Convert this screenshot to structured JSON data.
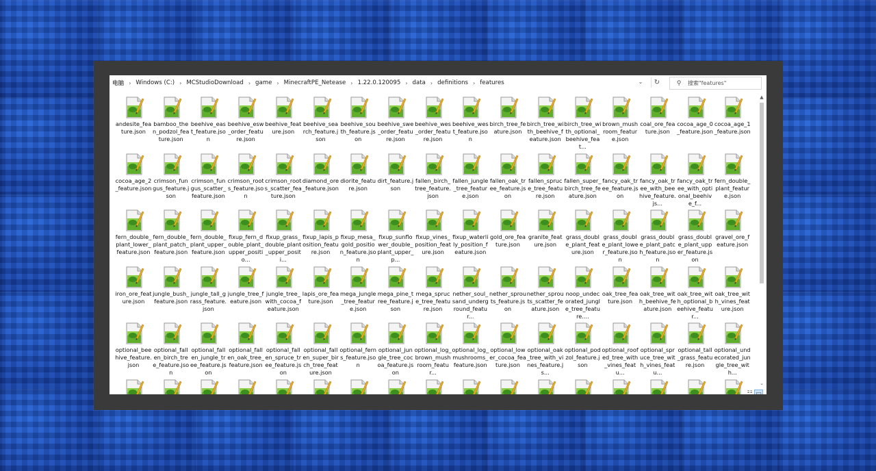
{
  "address_bar": {
    "crumbs": [
      "电脑",
      "Windows (C:)",
      "MCStudioDownload",
      "game",
      "MinecraftPE_Netease",
      "1.22.0.120095",
      "data",
      "definitions",
      "features"
    ],
    "search_placeholder": "搜索\"features\""
  },
  "files": [
    "andesite_feature.json",
    "bamboo_then_podzol_feature.json",
    "beehive_east_feature.json",
    "beehive_esw_order_feature.json",
    "beehive_feature.json",
    "beehive_search_feature.json",
    "beehive_south_feature.json",
    "beehive_swe_order_feature.json",
    "beehive_wes_order_feature.json",
    "beehive_west_feature.json",
    "birch_tree_feature.json",
    "birch_tree_with_beehive_feature.json",
    "birch_tree_with_optional_beehive_feat...",
    "brown_mushroom_feature.json",
    "coal_ore_feature.json",
    "cocoa_age_0_feature.json",
    "cocoa_age_1_feature.json",
    "cocoa_age_2_feature.json",
    "crimson_fungus_feature.json",
    "crimson_fungus_scatter_feature.json",
    "crimson_roots_feature.json",
    "crimson_roots_scatter_feature.json",
    "diamond_ore_feature.json",
    "diorite_feature.json",
    "dirt_feature.json",
    "fallen_birch_tree_feature.json",
    "fallen_jungle_tree_feature.json",
    "fallen_oak_tree_feature.json",
    "fallen_spruce_tree_feature.json",
    "fallen_super_birch_tree_feature.json",
    "fancy_oak_tree_feature.json",
    "fancy_oak_tree_with_beehive_feature.js...",
    "fancy_oak_tree_with_optional_beehive_f...",
    "fern_double_plant_feature.json",
    "fern_double_plant_lower_feature.json",
    "fern_double_plant_patch_feature.json",
    "fern_double_plant_upper_feature.json",
    "fixup_fern_double_plant_upper_positio...",
    "fixup_grass_double_plant_upper_positi...",
    "fixup_lapis_position_feature.json",
    "fixup_mesa_gold_position_feature.json",
    "fixup_sunflower_double_plant_upper_p...",
    "fixup_vines_position_feature.json",
    "fixup_waterlily_position_feature.json",
    "gold_ore_feature.json",
    "granite_feature.json",
    "grass_double_plant_feature.json",
    "grass_double_plant_lower_feature.json",
    "grass_double_plant_patch_feature.json",
    "grass_double_plant_upper_feature.json",
    "gravel_ore_feature.json",
    "iron_ore_feature.json",
    "jungle_bush_feature.json",
    "jungle_tall_grass_feature.json",
    "jungle_tree_feature.json",
    "jungle_tree_with_cocoa_feature.json",
    "lapis_ore_feature.json",
    "mega_jungle_tree_feature.json",
    "mega_pine_tree_feature.json",
    "mega_spruce_tree_feature.json",
    "nether_soul_sand_underground_featur...",
    "nether_sprouts_feature.json",
    "nether_sprouts_scatter_feature.json",
    "noop_undecorated_jungle_tree_feature....",
    "oak_tree_feature.json",
    "oak_tree_with_beehive_feature.json",
    "oak_tree_with_optional_beehive_featur...",
    "oak_tree_with_vines_feature.json",
    "optional_beehive_feature.json",
    "optional_fallen_birch_tree_feature.json",
    "optional_fallen_jungle_tree_feature.json",
    "optional_fallen_oak_tree_feature.json",
    "optional_fallen_spruce_tree_feature.json",
    "optional_fallen_super_birch_tree_feature.json",
    "optional_ferns_feature.json",
    "optional_jungle_tree_cocoa_feature.json",
    "optional_log_brown_mushroom_featur...",
    "optional_log_mushrooms_feature.json",
    "optional_lower_cocoa_feature.json",
    "optional_oak_tree_with_vines_feature.js...",
    "optional_podzol_feature.json",
    "optional_roofed_tree_with_vines_featu...",
    "optional_spruce_tree_with_vines_featu...",
    "optional_tall_grass_feature.json",
    "optional_undecorated_jungle_tree_with..."
  ],
  "colors": {
    "frame": "#3a3a3a",
    "window": "#ffffff",
    "desktop": "#1d4fb8"
  },
  "icon": "notepad-plus-plus-file-icon"
}
